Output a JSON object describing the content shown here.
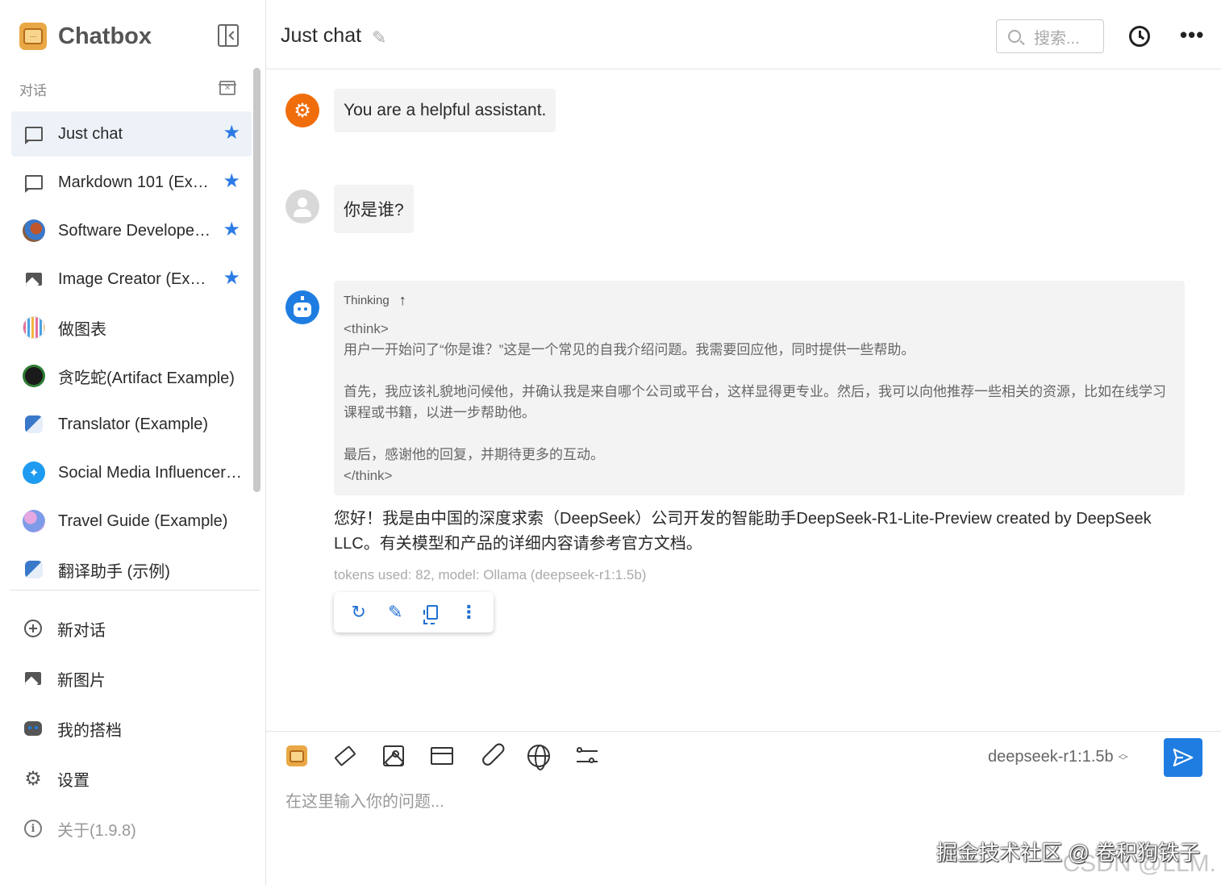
{
  "sidebar": {
    "brand": "Chatbox",
    "section_label": "对话",
    "conversations": [
      {
        "label": "Just chat",
        "starred": true,
        "active": true,
        "icon": "chat-bubble-icon"
      },
      {
        "label": "Markdown 101 (Example)",
        "starred": true,
        "icon": "chat-bubble-icon"
      },
      {
        "label": "Software Developer (Example)",
        "starred": true,
        "icon": "developer-avatar"
      },
      {
        "label": "Image Creator (Example)",
        "starred": true,
        "icon": "image-icon"
      },
      {
        "label": "做图表",
        "starred": false,
        "icon": "chart-avatar"
      },
      {
        "label": "贪吃蛇(Artifact Example)",
        "starred": false,
        "icon": "snake-avatar"
      },
      {
        "label": "Translator (Example)",
        "starred": false,
        "icon": "translate-avatar"
      },
      {
        "label": "Social Media Influencer (Example)",
        "starred": false,
        "icon": "twitter-avatar"
      },
      {
        "label": "Travel Guide (Example)",
        "starred": false,
        "icon": "globe-avatar"
      },
      {
        "label": "翻译助手 (示例)",
        "starred": false,
        "icon": "translate-avatar"
      }
    ],
    "nav": {
      "new_chat": "新对话",
      "new_image": "新图片",
      "my_copilots": "我的搭档",
      "settings": "设置",
      "about": "关于(1.9.8)"
    }
  },
  "header": {
    "title": "Just chat",
    "search_placeholder": "搜索..."
  },
  "messages": {
    "system": "You are a helpful assistant.",
    "user": "你是谁?",
    "thinking_label": "Thinking",
    "thinking_text": "<think>\n用户一开始问了“你是谁？”这是一个常见的自我介绍问题。我需要回应他，同时提供一些帮助。\n\n首先，我应该礼貌地问候他，并确认我是来自哪个公司或平台，这样显得更专业。然后，我可以向他推荐一些相关的资源，比如在线学习课程或书籍，以进一步帮助他。\n\n最后，感谢他的回复，并期待更多的互动。\n</think>",
    "answer": "您好！我是由中国的深度求索（DeepSeek）公司开发的智能助手DeepSeek-R1-Lite-Preview created by DeepSeek LLC。有关模型和产品的详细内容请参考官方文档。",
    "meta": "tokens used: 82, model: Ollama (deepseek-r1:1.5b)"
  },
  "composer": {
    "model": "deepseek-r1:1.5b",
    "placeholder": "在这里输入你的问题..."
  },
  "watermark": {
    "line1": "掘金技术社区 @ 卷积狗铁子",
    "line2": "CSDN @LLM."
  },
  "colors": {
    "accent": "#1f7de1",
    "system_avatar": "#f06d0c",
    "star": "#2c7be5"
  }
}
